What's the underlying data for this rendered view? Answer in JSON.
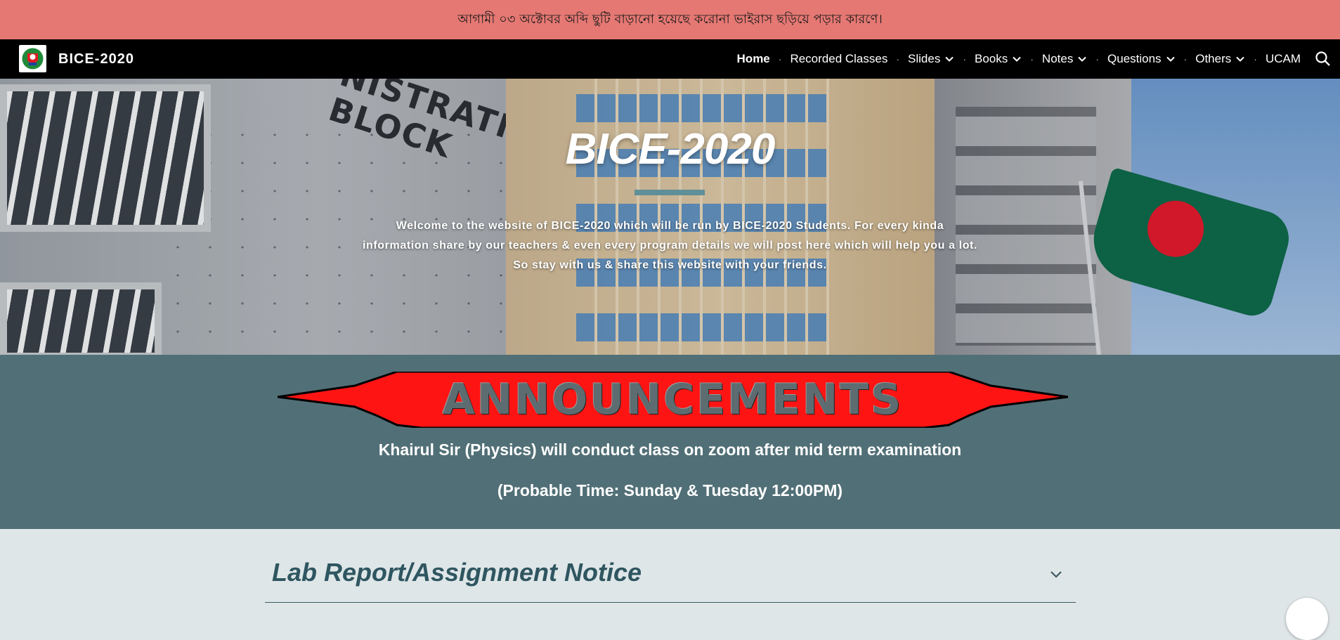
{
  "banner": {
    "text": "আগামী ০৩ অক্টোবর অব্দি ছুটি বাড়ানো হয়েছে করোনা ভাইরাস ছড়িয়ে পড়ার কারণে।"
  },
  "header": {
    "site_title": "BICE-2020",
    "logo_icon": "university-crest-logo"
  },
  "nav": {
    "items": [
      {
        "label": "Home",
        "active": true,
        "dropdown": false
      },
      {
        "label": "Recorded Classes",
        "active": false,
        "dropdown": false
      },
      {
        "label": "Slides",
        "active": false,
        "dropdown": true
      },
      {
        "label": "Books",
        "active": false,
        "dropdown": true
      },
      {
        "label": "Notes",
        "active": false,
        "dropdown": true
      },
      {
        "label": "Questions",
        "active": false,
        "dropdown": true
      },
      {
        "label": "Others",
        "active": false,
        "dropdown": true
      },
      {
        "label": "UCAM",
        "active": false,
        "dropdown": false
      }
    ],
    "search_icon": "search-icon"
  },
  "hero": {
    "title": "BICE-2020",
    "line1": "Welcome to the website of BICE-2020 which will be run by BICE-2020 Students. For every kinda",
    "line2": "information share by our teachers & even every program details we will post here which will help you a lot.",
    "line3": "So stay with us & share this website with your friends.",
    "sign_line1": "NISTRATIVE",
    "sign_line2": "BLOCK"
  },
  "announcements": {
    "banner_text": "ANNOUNCEMENTS",
    "line1": "Khairul Sir (Physics) will conduct class on zoom after mid term examination",
    "line2": "(Probable Time: Sunday & Tuesday 12:00PM)"
  },
  "lab": {
    "title": "Lab Report/Assignment Notice"
  },
  "colors": {
    "banner_bg": "#e57873",
    "nav_bg": "#000000",
    "announce_bg": "#516f76",
    "page_bg": "#dfe6e8",
    "accent_rule": "#5f8f97",
    "lab_title": "#2f5660"
  }
}
